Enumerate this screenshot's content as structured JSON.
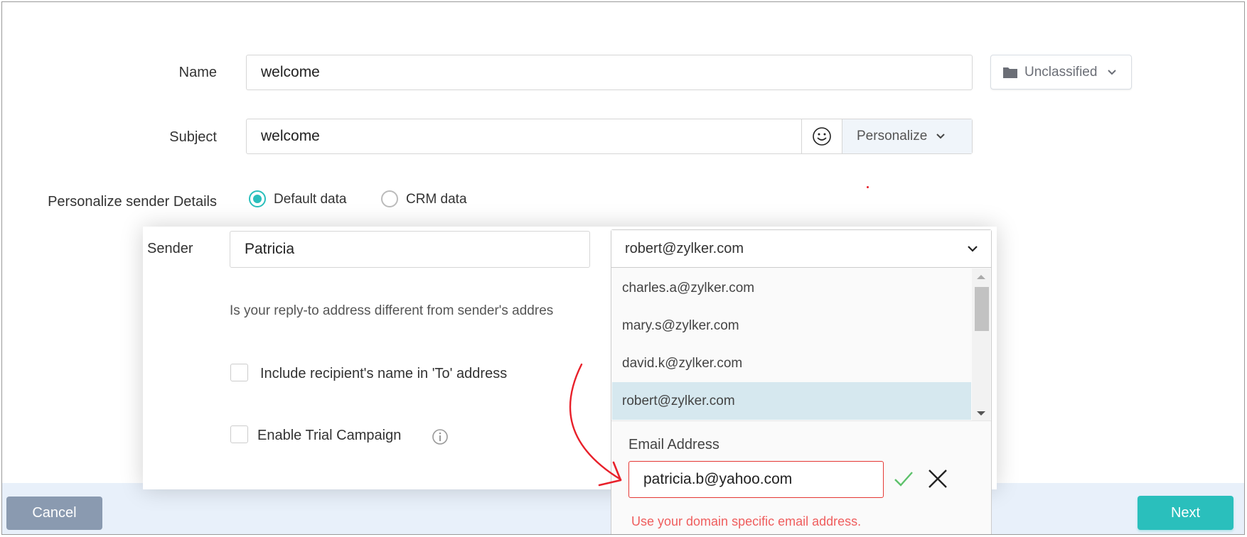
{
  "form": {
    "name_label": "Name",
    "name_value": "welcome",
    "category": {
      "label": "Unclassified",
      "icon": "folder-icon"
    },
    "subject_label": "Subject",
    "subject_value": "welcome",
    "emoji_icon": "smiley-icon",
    "personalize_label": "Personalize",
    "sender_details_label": "Personalize sender Details",
    "radio_options": [
      {
        "label": "Default data",
        "selected": true
      },
      {
        "label": "CRM data",
        "selected": false
      }
    ]
  },
  "sender_panel": {
    "sender_label": "Sender",
    "sender_name": "Patricia",
    "reply_to_question": "Is your reply-to address different from sender's addres",
    "checkboxes": [
      {
        "label": "Include recipient's name in 'To' address",
        "checked": false
      },
      {
        "label": "Enable Trial Campaign",
        "checked": false,
        "info_icon": "info-icon"
      }
    ]
  },
  "sender_email_dropdown": {
    "selected": "robert@zylker.com",
    "options": [
      {
        "label": "charles.a@zylker.com",
        "highlighted": false
      },
      {
        "label": "mary.s@zylker.com",
        "highlighted": false
      },
      {
        "label": "david.k@zylker.com",
        "highlighted": false
      },
      {
        "label": "robert@zylker.com",
        "highlighted": true
      }
    ],
    "new_email": {
      "label": "Email Address",
      "value": "patricia.b@yahoo.com",
      "error": "Use your domain specific email address.",
      "confirm_icon": "check-icon",
      "cancel_icon": "close-icon"
    }
  },
  "footer": {
    "cancel_label": "Cancel",
    "next_label": "Next"
  },
  "colors": {
    "accent": "#2abfbc",
    "error": "#e53935",
    "annotation": "#e8202a",
    "highlight_row": "#d6e8ef"
  }
}
